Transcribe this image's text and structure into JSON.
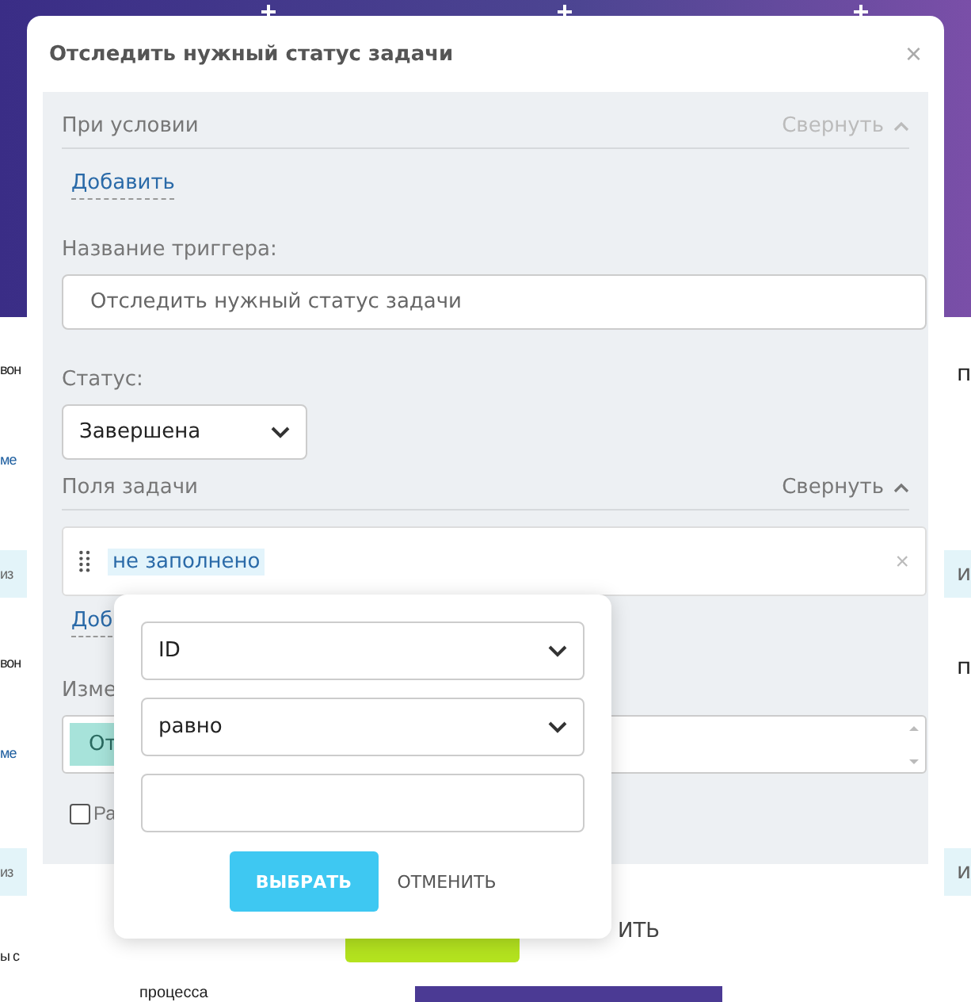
{
  "background": {
    "left_texts": [
      "вон",
      "ме",
      "из",
      "вон",
      "ме",
      "из",
      "ы с"
    ],
    "right_texts": [
      "п",
      "и",
      "п",
      "и"
    ],
    "bottom_text": "процесса"
  },
  "dialog": {
    "title": "Отследить нужный статус задачи",
    "close": "×",
    "conditions": {
      "title": "При условии",
      "collapse": "Свернуть",
      "disabled": true,
      "add": "Добавить"
    },
    "trigger_name": {
      "label": "Название триггера:",
      "value": "Отследить нужный статус задачи"
    },
    "status": {
      "label": "Статус:",
      "value": "Завершена"
    },
    "task_fields": {
      "title": "Поля задачи",
      "collapse": "Свернуть",
      "disabled": false,
      "filter_chip": "не заполнено",
      "remove": "×",
      "add": "Доб"
    },
    "change": {
      "label": "Изме",
      "chip": "От"
    },
    "checkbox": {
      "label": "Ра",
      "checked": false
    },
    "footer": {
      "cancel": "ИТЬ"
    }
  },
  "popover": {
    "field": "ID",
    "operator": "равно",
    "confirm": "ВЫБРАТЬ",
    "cancel": "ОТМЕНИТЬ"
  }
}
